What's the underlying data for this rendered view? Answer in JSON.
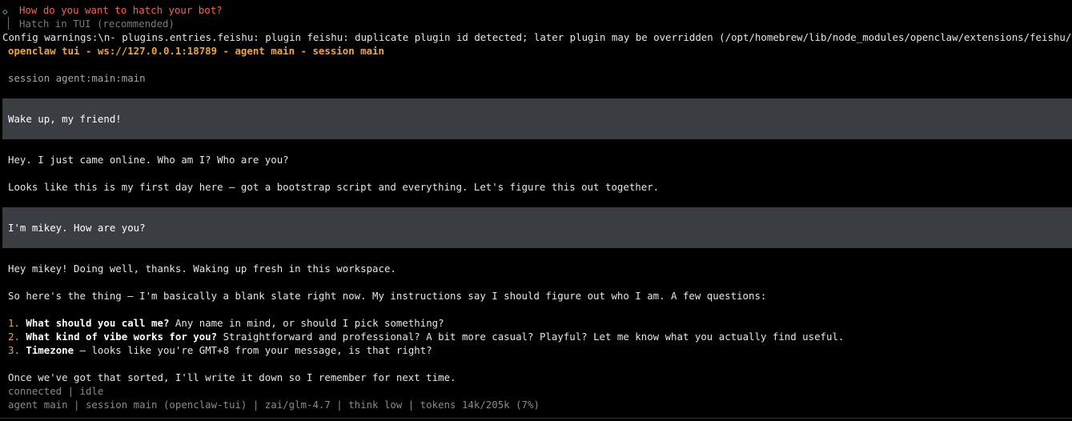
{
  "wizard": {
    "question": "How do you want to hatch your bot?",
    "option": "Hatch in TUI (recommended)",
    "marker": "◇"
  },
  "config_warning": "Config warnings:\\n- plugins.entries.feishu: plugin feishu: duplicate plugin id detected; later plugin may be overridden (/opt/homebrew/lib/node_modules/openclaw/extensions/feishu/index.ts)",
  "header": "openclaw tui - ws://127.0.0.1:18789 - agent main - session main",
  "session_line": "session agent:main:main",
  "messages": {
    "user1": "Wake up, my friend!",
    "assistant1_line1": "Hey. I just came online. Who am I? Who are you?",
    "assistant1_line2": "Looks like this is my first day here — got a bootstrap script and everything. Let's figure this out together.",
    "user2": "I'm mikey. How are you?",
    "assistant2_line1": "Hey mikey! Doing well, thanks. Waking up fresh in this workspace.",
    "assistant2_line2": "So here's the thing — I'm basically a blank slate right now. My instructions say I should figure out who I am. A few questions:",
    "questions": [
      {
        "num": "1.",
        "bold": "What should you call me?",
        "rest": " Any name in mind, or should I pick something?"
      },
      {
        "num": "2.",
        "bold": "What kind of vibe works for you?",
        "rest": " Straightforward and professional? A bit more casual? Playful? Let me know what you actually find useful."
      },
      {
        "num": "3.",
        "bold": "Timezone",
        "rest": " — looks like you're GMT+8 from your message, is that right?"
      }
    ],
    "closing": "Once we've got that sorted, I'll write it down so I remember for next time."
  },
  "status": {
    "connection": "connected | idle",
    "info": "agent main | session main (openclaw-tui) | zai/glm-4.7 | think low | tokens 14k/205k (7%)"
  },
  "colors": {
    "background": "#000000",
    "accent_orange": "#f0a43a",
    "prompt_red": "#ff5f4f",
    "marker_green": "#5fd35f",
    "user_block": "#3a3d42"
  }
}
